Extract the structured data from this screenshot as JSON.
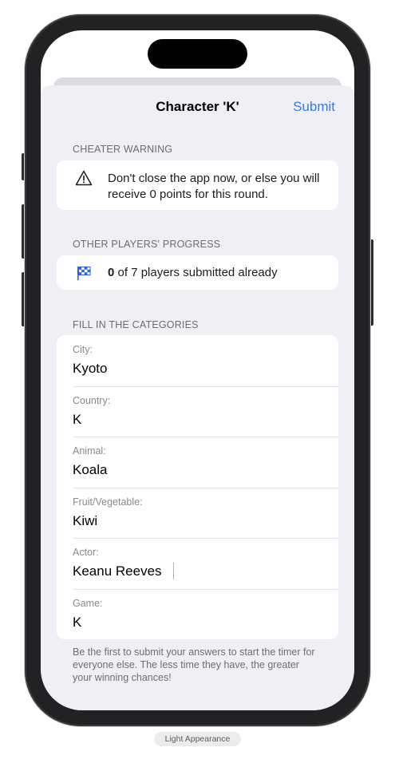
{
  "nav": {
    "title": "Character 'K'",
    "submit_label": "Submit"
  },
  "warning": {
    "header": "CHEATER WARNING",
    "icon": "warning-triangle-icon",
    "text": "Don't close the app now, or else you will receive 0 points for this round."
  },
  "progress": {
    "header": "OTHER PLAYERS' PROGRESS",
    "icon": "checkered-flag-icon",
    "submitted_count": "0",
    "rest_text": " of 7 players submitted already"
  },
  "categories": {
    "header": "FILL IN THE CATEGORIES",
    "items": [
      {
        "label": "City:",
        "value": "Kyoto"
      },
      {
        "label": "Country:",
        "value": "K"
      },
      {
        "label": "Animal:",
        "value": "Koala"
      },
      {
        "label": "Fruit/Vegetable:",
        "value": "Kiwi"
      },
      {
        "label": "Actor:",
        "value": "Keanu Reeves"
      },
      {
        "label": "Game:",
        "value": "K"
      }
    ],
    "footer": "Be the first to submit your answers to start the timer for everyone else. The less time they have, the greater your winning chances!"
  },
  "appearance_label": "Light Appearance",
  "colors": {
    "accent": "#2f7cf6",
    "sheet_background": "#efeff4",
    "flag_blue": "#2f63d6"
  }
}
